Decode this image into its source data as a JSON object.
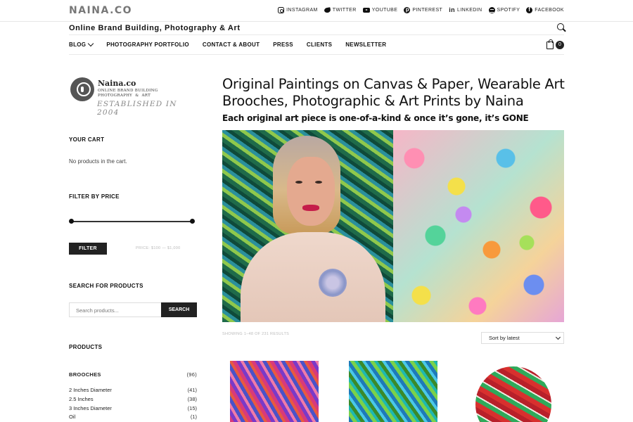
{
  "topbar": {
    "brand": "NAINA.CO",
    "social": [
      {
        "label": "INSTAGRAM",
        "icon": "instagram-icon"
      },
      {
        "label": "TWITTER",
        "icon": "twitter-icon"
      },
      {
        "label": "YOUTUBE",
        "icon": "youtube-icon"
      },
      {
        "label": "PINTEREST",
        "icon": "pinterest-icon"
      },
      {
        "label": "LINKEDIN",
        "icon": "linkedin-icon"
      },
      {
        "label": "SPOTIFY",
        "icon": "spotify-icon"
      },
      {
        "label": "FACEBOOK",
        "icon": "facebook-icon"
      }
    ]
  },
  "header": {
    "tagline": "Online Brand Building, Photography & Art"
  },
  "nav": {
    "items": [
      "BLOG",
      "PHOTOGRAPHY PORTFOLIO",
      "CONTACT & ABOUT",
      "PRESS",
      "CLIENTS",
      "NEWSLETTER"
    ],
    "cart_count": "0"
  },
  "sidebar": {
    "logo": {
      "name": "Naina.co",
      "sub1": "ONLINE BRAND BUILDING",
      "sub2": "PHOTOGRAPHY  &  ART",
      "established": "ESTABLISHED IN 2004"
    },
    "cart_heading": "YOUR CART",
    "cart_empty": "No products in the cart.",
    "filter_heading": "FILTER BY PRICE",
    "filter_button": "FILTER",
    "price_text": "PRICE: $100 — $1,000",
    "search_heading": "SEARCH FOR PRODUCTS",
    "search_placeholder": "Search products...",
    "search_button": "SEARCH",
    "products_heading": "PRODUCTS",
    "categories": [
      {
        "name": "BROOCHES",
        "count": "(96)"
      },
      {
        "name": "2 Inches Diameter",
        "count": "(41)"
      },
      {
        "name": "2.5 Inches",
        "count": "(38)"
      },
      {
        "name": "3 Inches Diameter",
        "count": "(15)"
      },
      {
        "name": "Oil",
        "count": "(1)"
      }
    ]
  },
  "main": {
    "title": "Original Paintings on Canvas & Paper, Wearable Art Brooches, Photographic & Art Prints by Naina",
    "subtitle": "Each original art piece is one-of-a-kind & once it’s gone, it’s GONE",
    "results": "SHOWING 1–48 OF 231 RESULTS",
    "sort_value": "Sort by latest"
  },
  "colors": {
    "accent": "#222222",
    "brand_gray": "#777777"
  }
}
